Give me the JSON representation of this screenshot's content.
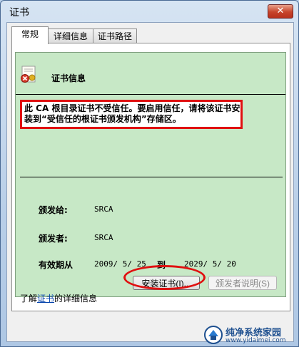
{
  "window": {
    "title": "证书",
    "close_label": "✕"
  },
  "tabs": [
    {
      "label": "常规",
      "active": true
    },
    {
      "label": "详细信息",
      "active": false
    },
    {
      "label": "证书路径",
      "active": false
    }
  ],
  "info": {
    "title": "证书信息",
    "warning": "此 CA 根目录证书不受信任。要启用信任，请将该证书安装到“受信任的根证书颁发机构”存储区。"
  },
  "fields": {
    "issued_to_label": "颁发给:",
    "issued_to_value": "SRCA",
    "issued_by_label": "颁发者:",
    "issued_by_value": "SRCA",
    "validity_label": "有效期从",
    "validity_from": "2009/ 5/ 25",
    "validity_to_label": "到",
    "validity_to": "2029/ 5/ 20"
  },
  "buttons": {
    "install": "安装证书(I)...",
    "issuer_statement": "颁发者说明(S)"
  },
  "footer": {
    "learn_prefix": "了解",
    "learn_link": "证书",
    "learn_suffix": "的详细信息"
  },
  "watermark": {
    "name": "纯净系统家园",
    "url": "www.yidaimei.com"
  },
  "colors": {
    "info_bg": "#c7e8c6",
    "highlight_red": "#e01010",
    "link": "#0645ad"
  }
}
